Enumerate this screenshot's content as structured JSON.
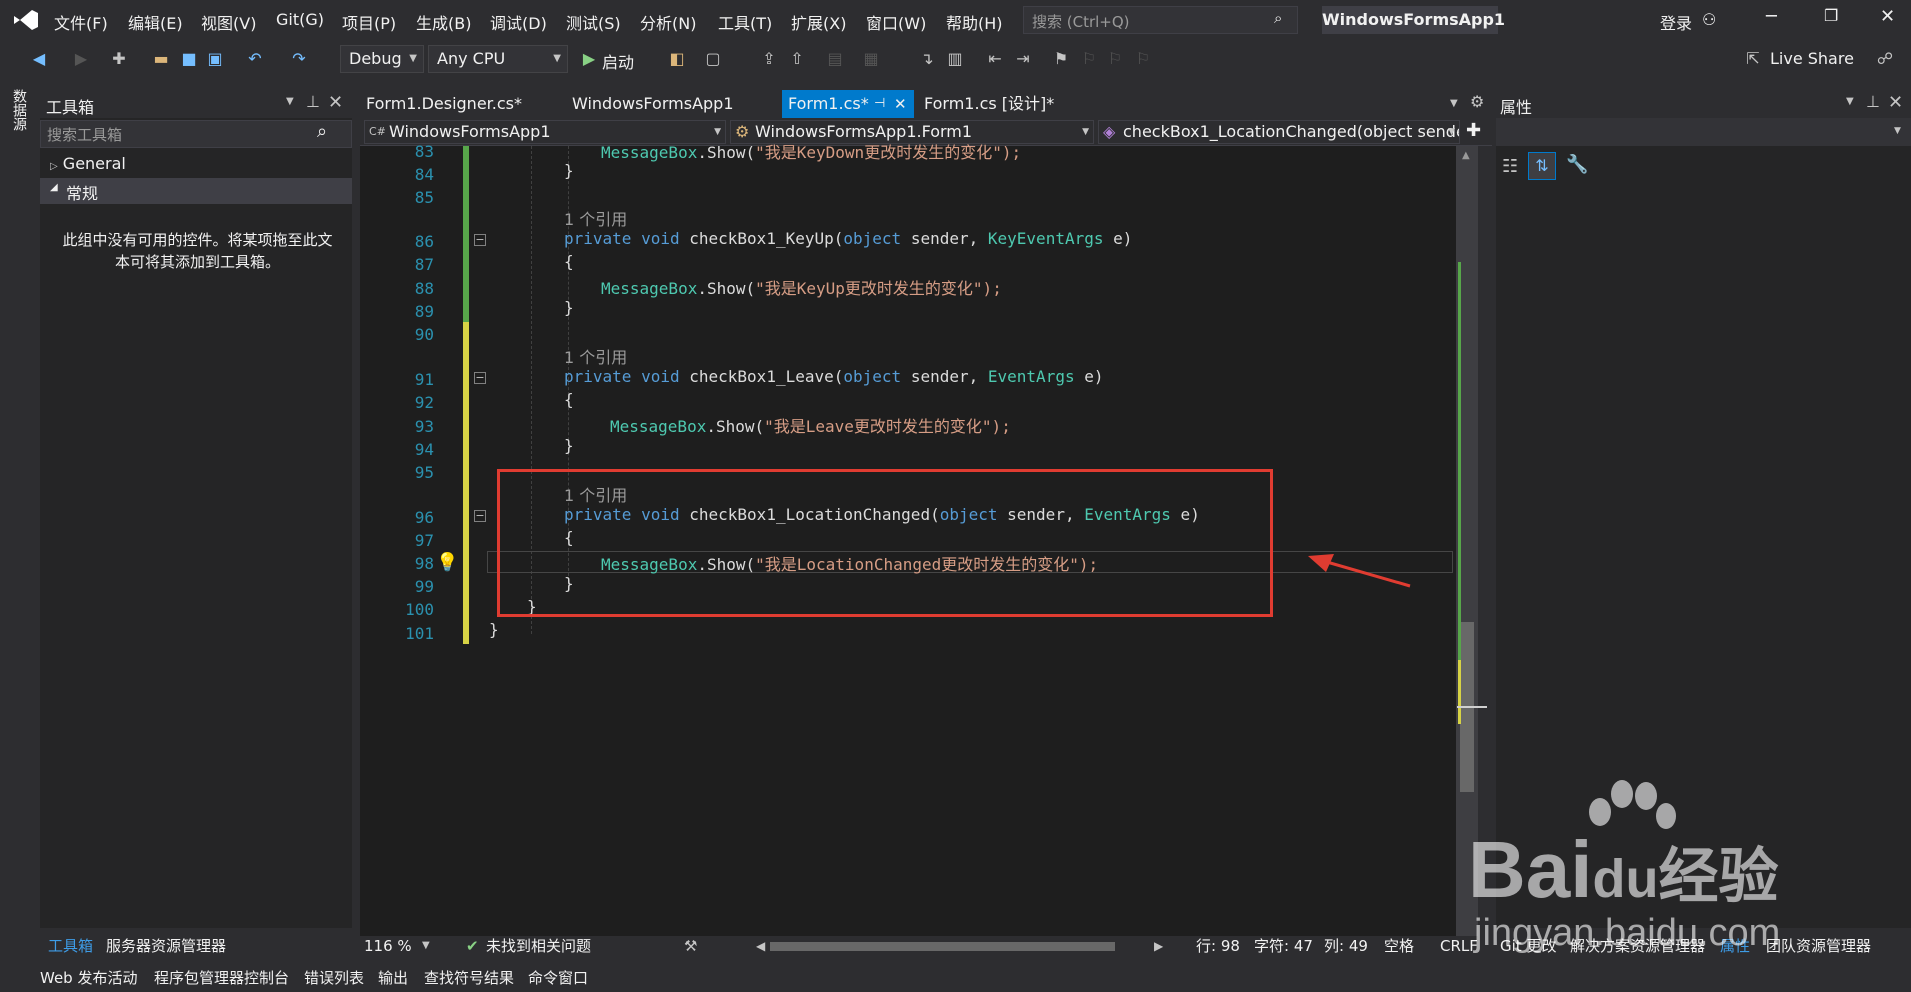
{
  "menu": {
    "items": [
      "文件(F)",
      "编辑(E)",
      "视图(V)",
      "Git(G)",
      "项目(P)",
      "生成(B)",
      "调试(D)",
      "测试(S)",
      "分析(N)",
      "工具(T)",
      "扩展(X)",
      "窗口(W)",
      "帮助(H)"
    ],
    "search_placeholder": "搜索 (Ctrl+Q)",
    "solution_name": "WindowsFormsApp1",
    "login": "登录"
  },
  "toolbar": {
    "config": "Debug",
    "platform": "Any CPU",
    "start": "启动",
    "live_share": "Live Share"
  },
  "left_strip": {
    "label": "数据源"
  },
  "toolbox": {
    "title": "工具箱",
    "search_placeholder": "搜索工具箱",
    "groups": [
      "General",
      "常规"
    ],
    "empty_text_line1": "此组中没有可用的控件。将某项拖至此文",
    "empty_text_line2": "本可将其添加到工具箱。",
    "bottom_tabs": [
      "工具箱",
      "服务器资源管理器"
    ]
  },
  "doc_tabs": [
    "Form1.Designer.cs*",
    "WindowsFormsApp1",
    "Form1.cs*",
    "Form1.cs [设计]*"
  ],
  "nav": {
    "project": "WindowsFormsApp1",
    "class": "WindowsFormsApp1.Form1",
    "member": "checkBox1_LocationChanged(object sender,"
  },
  "editor": {
    "line_numbers": [
      "83",
      "84",
      "85",
      "86",
      "87",
      "88",
      "89",
      "90",
      "91",
      "92",
      "93",
      "94",
      "95",
      "96",
      "97",
      "98",
      "99",
      "100",
      "101"
    ],
    "codelens": "1 个引用",
    "kw_private": "private",
    "kw_void": "void",
    "kw_object": "object",
    "t_keyeventargs": "KeyEventArgs",
    "t_eventargs": "EventArgs",
    "t_messagebox": "MessageBox",
    "show_call": ".Show(",
    "m_keyup": "checkBox1_KeyUp",
    "m_leave": "checkBox1_Leave",
    "m_locchanged": "checkBox1_LocationChanged",
    "s_keydown": "\"我是KeyDown更改时发生的变化\");",
    "s_keyup": "\"我是KeyUp更改时发生的变化\");",
    "s_leave": "\"我是Leave更改时发生的变化\");",
    "s_loc": "\"我是LocationChanged更改时发生的变化\");",
    "param_sender": " sender, ",
    "param_e": " e)",
    "open_paren": "(",
    "brace_open": "{",
    "brace_close": "}"
  },
  "editor_status": {
    "zoom": "116 %",
    "issues": "未找到相关问题",
    "line": "行: 98",
    "char": "字符: 47",
    "col": "列: 49",
    "spaces": "空格",
    "eol": "CRLF"
  },
  "properties": {
    "title": "属性",
    "bottom_tabs": [
      "Git 更改",
      "解决方案资源管理器",
      "属性",
      "团队资源管理器"
    ]
  },
  "statusbar": {
    "items": [
      "Web 发布活动",
      "程序包管理器控制台",
      "错误列表",
      "输出",
      "查找符号结果",
      "命令窗口"
    ]
  },
  "watermark": {
    "brand": "Bai",
    "brand2": "du",
    "cn": "经验",
    "url": "jingyan.baidu.com"
  },
  "colors": {
    "accent": "#007acc",
    "annotation": "#e03c31",
    "keyword": "#569cd6",
    "type": "#4ec9b0",
    "string": "#d69d85"
  }
}
